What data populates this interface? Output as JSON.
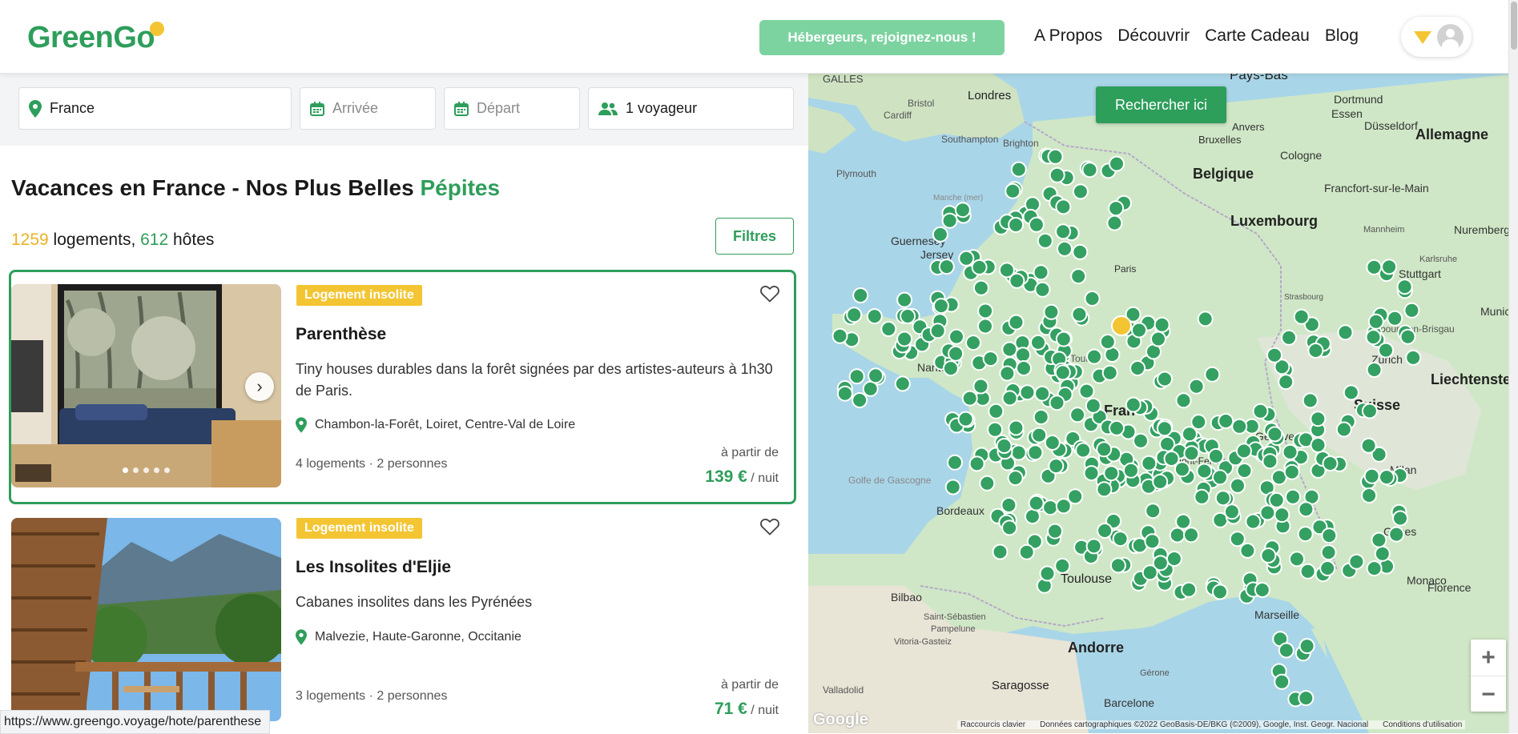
{
  "header": {
    "logo": "GreenGo",
    "host_button": "Hébergeurs, rejoignez-nous !",
    "nav": [
      "A Propos",
      "Découvrir",
      "Carte Cadeau",
      "Blog"
    ]
  },
  "search": {
    "destination": "France",
    "arrival_placeholder": "Arrivée",
    "departure_placeholder": "Départ",
    "guests": "1 voyageur"
  },
  "listing": {
    "title_main": "Vacances en France - Nos Plus Belles ",
    "title_accent": "Pépites",
    "count_logements": "1259",
    "count_logements_label": " logements, ",
    "count_hotes": "612",
    "count_hotes_label": " hôtes",
    "filters_button": "Filtres"
  },
  "cards": [
    {
      "badge": "Logement insolite",
      "title": "Parenthèse",
      "description": "Tiny houses durables dans la forêt signées par des artistes-auteurs à 1h30 de Paris.",
      "location": "Chambon-la-Forêt, Loiret, Centre-Val de Loire",
      "meta": "4 logements · 2 personnes",
      "price_from": "à partir de",
      "price": "139 €",
      "price_unit": " / nuit"
    },
    {
      "badge": "Logement insolite",
      "title": "Les Insolites d'Eljie",
      "description": "Cabanes insolites dans les Pyrénées",
      "location": "Malvezie, Haute-Garonne, Occitanie",
      "meta": "3 logements · 2 personnes",
      "price_from": "à partir de",
      "price": "71 €",
      "price_unit": " / nuit"
    }
  ],
  "map": {
    "search_here": "Rechercher ici",
    "labels": [
      "GALLES",
      "Londres",
      "Pays-Bas",
      "Bristol",
      "Cardiff",
      "Dortmund",
      "Essen",
      "Düsseldorf",
      "Anvers",
      "Bruxelles",
      "Cologne",
      "Allemagne",
      "Southampton",
      "Brighton",
      "Plymouth",
      "Belgique",
      "Francfort-sur-le-Main",
      "Manche (mer)",
      "Luxembourg",
      "Mannheim",
      "Nuremberg",
      "Guernesey",
      "Jersey",
      "Karlsruhe",
      "Stuttgart",
      "Strasbourg",
      "Munic",
      "Fribourg-en-Brisgau",
      "Zurich",
      "Liechtenstein",
      "Tours",
      "Nantes",
      "France",
      "Suisse",
      "Genève",
      "Golfe de Gascogne",
      "Milan",
      "Gênes",
      "Bordeaux",
      "Toulouse",
      "Monaco",
      "Florence",
      "Bilbao",
      "Marseille",
      "Saint-Sébastien",
      "Pampelune",
      "Vitoria-Gasteiz",
      "Andorre",
      "Gérone",
      "Valladolid",
      "Saragosse",
      "Barcelone",
      "Paris",
      "Clermont-Ferrand"
    ],
    "footer": [
      "Raccourcis clavier",
      "Données cartographiques ©2022 GeoBasis-DE/BKG (©2009), Google, Inst. Geogr. Nacional",
      "Conditions d'utilisation"
    ],
    "google": "Google"
  },
  "status_url": "https://www.greengo.voyage/hote/parenthese"
}
